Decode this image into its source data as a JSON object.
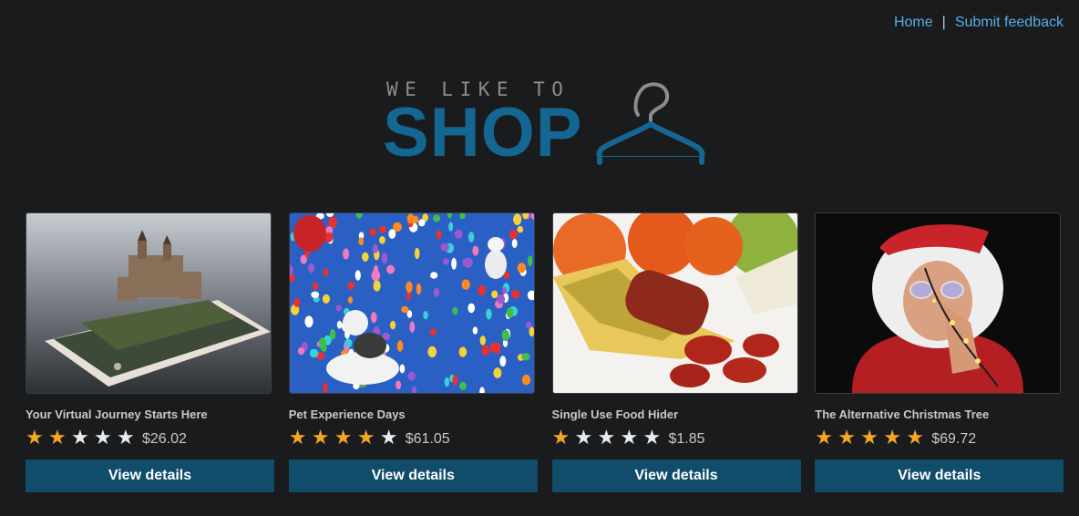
{
  "nav": {
    "home": "Home",
    "separator": "|",
    "feedback": "Submit feedback",
    "link_color": "#58aee6"
  },
  "logo": {
    "tagline": "WE LIKE TO",
    "brand": "SHOP",
    "brand_color": "#156793",
    "icon": "hanger-icon"
  },
  "products": [
    {
      "title": "Your Virtual Journey Starts Here",
      "rating": 2,
      "price": "$26.02",
      "button": "View details",
      "image": "phone-castle-image"
    },
    {
      "title": "Pet Experience Days",
      "rating": 4,
      "price": "$61.05",
      "button": "View details",
      "image": "dogs-balloons-image"
    },
    {
      "title": "Single Use Food Hider",
      "rating": 1,
      "price": "$1.85",
      "button": "View details",
      "image": "banana-sausage-image"
    },
    {
      "title": "The Alternative Christmas Tree",
      "rating": 5,
      "price": "$69.72",
      "button": "View details",
      "image": "santa-lights-image"
    }
  ],
  "colors": {
    "background": "#1a1b1d",
    "button": "#114c6b",
    "star_on": "#f5a623",
    "star_off": "#e8ecef"
  }
}
